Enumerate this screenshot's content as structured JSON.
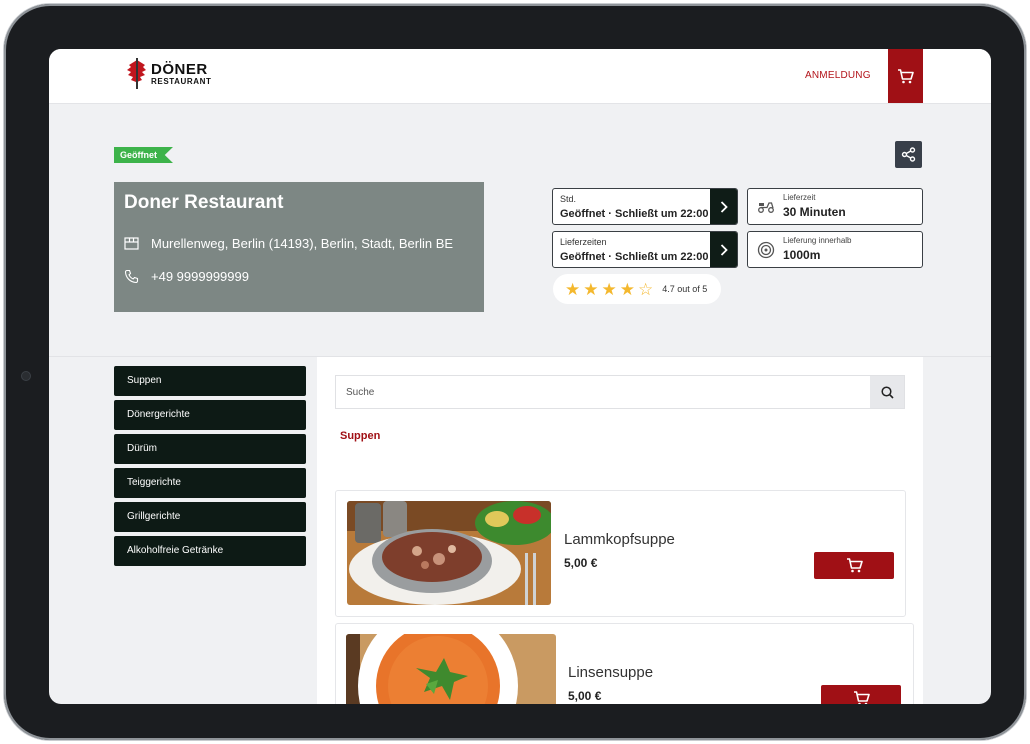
{
  "header": {
    "logo_main": "DÖNER",
    "logo_sub": "RESTAURANT",
    "login_label": "ANMELDUNG"
  },
  "status": {
    "badge": "Geöffnet"
  },
  "restaurant": {
    "name": "Doner Restaurant",
    "address": "Murellenweg, Berlin (14193), Berlin, Stadt, Berlin BE",
    "phone": "+49 9999999999"
  },
  "hours": {
    "opening_label": "Std.",
    "opening_value": "Geöffnet · Schließt um 22:00",
    "delivery_label": "Lieferzeiten",
    "delivery_value": "Geöffnet · Schließt um 22:00"
  },
  "delivery": {
    "time_label": "Lieferzeit",
    "time_value": "30 Minuten",
    "radius_label": "Lieferung innerhalb",
    "radius_value": "1000m"
  },
  "rating": {
    "value": 4.7,
    "max": 5,
    "text": "4.7 out of 5"
  },
  "categories": [
    "Suppen",
    "Dönergerichte",
    "Dürüm",
    "Teiggerichte",
    "Grillgerichte",
    "Alkoholfreie Getränke"
  ],
  "search": {
    "placeholder": "Suche"
  },
  "section": {
    "title": "Suppen"
  },
  "products": [
    {
      "name": "Lammkopfsuppe",
      "price": "5,00 €"
    },
    {
      "name": "Linsensuppe",
      "price": "5,00 €"
    }
  ],
  "colors": {
    "brand_red": "#a01015",
    "dark_green": "#0d1a15",
    "open_green": "#3db34a",
    "star": "#f4b82e",
    "info_card": "#7d8784"
  }
}
